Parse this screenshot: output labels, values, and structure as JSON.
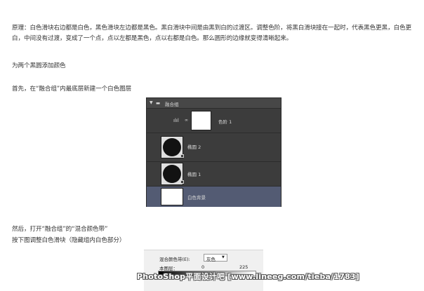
{
  "article": {
    "principle": "原理：白色滑块右边都是白色，黑色滑块左边都是黑色。黑白滑块中间是由黑到白的过渡区。调整色阶，将黑白滑块接在一起时，代表黑色更黑，白色更白，中间没有过渡，变成了一个点，点以左都是黑色，点以右都是白色。那么圆形的边缘就变得清晰起来。",
    "step_title": "为两个黑圆添加颜色",
    "step1": "首先，在“融合组”内最底层新建一个白色图层",
    "step2": "然后，打开“融合组”的“混合颜色带”",
    "step3": "按下图调整白色滑块（隐藏组内白色部分）"
  },
  "layers_panel": {
    "group_name": "融合组",
    "layers": [
      {
        "name": "色阶 1",
        "type": "adjustment"
      },
      {
        "name": "椭圆 2",
        "type": "ellipse"
      },
      {
        "name": "椭圆 1",
        "type": "ellipse"
      },
      {
        "name": "白色背景",
        "type": "fill",
        "selected": true
      }
    ]
  },
  "blend_dialog": {
    "label": "混合颜色带(E):",
    "select_value": "灰色",
    "this_layer_label": "本图层：",
    "black_value": "0",
    "white_value": "225"
  },
  "watermark": "PhotoShop平面设计吧 [www.lineeg.com/tieba/1783]",
  "colors": {
    "panel_bg": "#3c3c3c",
    "selected_row": "#535b73",
    "text": "#333333"
  }
}
